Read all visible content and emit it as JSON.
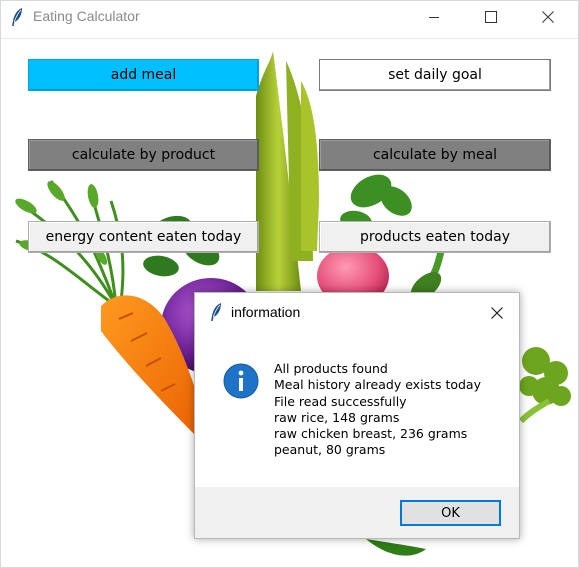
{
  "window": {
    "title": "Eating Calculator",
    "icon": "feather-icon"
  },
  "buttons": {
    "add_meal": "add meal",
    "set_daily_goal": "set daily goal",
    "calculate_by_product": "calculate by product",
    "calculate_by_meal": "calculate by meal",
    "energy_content_today": "energy content eaten today",
    "products_eaten_today": "products eaten today"
  },
  "dialog": {
    "title": "information",
    "icon": "info-icon",
    "lines": [
      "All products found",
      "Meal history already exists today",
      "File read successfully",
      "raw rice, 148 grams",
      "raw chicken breast, 236 grams",
      "peanut, 80 grams"
    ],
    "ok_label": "OK"
  },
  "colors": {
    "add_meal_bg": "#00bfff",
    "calc_buttons_bg": "#808080",
    "dialog_accent": "#0078d7"
  }
}
